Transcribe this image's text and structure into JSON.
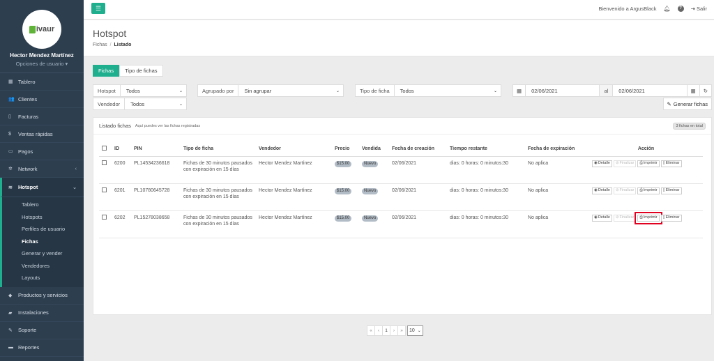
{
  "app": {
    "logo_text": "ivaur",
    "user_name": "Hector Mendez Martínez",
    "user_options": "Opciones de usuario ▾"
  },
  "sidebar": {
    "items_top": [
      {
        "icon": "dashboard-icon",
        "glyph": "▦",
        "label": "Tablero"
      },
      {
        "icon": "users-icon",
        "glyph": "👥",
        "label": "Clientes"
      },
      {
        "icon": "file-icon",
        "glyph": "▯",
        "label": "Facturas"
      },
      {
        "icon": "dollar-icon",
        "glyph": "$",
        "label": "Ventas rápidas"
      },
      {
        "icon": "money-icon",
        "glyph": "▭",
        "label": "Pagos"
      },
      {
        "icon": "network-icon",
        "glyph": "✲",
        "label": "Network",
        "caret": "‹"
      }
    ],
    "active": {
      "icon": "wifi-icon",
      "glyph": "≋",
      "label": "Hotspot",
      "caret": "⌄"
    },
    "subitems": [
      "Tablero",
      "Hotspots",
      "Perfiles de usuario",
      "Fichas",
      "Generar y vender",
      "Vendedores",
      "Layouts"
    ],
    "current_sub": "Fichas",
    "items_bottom": [
      {
        "icon": "tag-icon",
        "glyph": "◆",
        "label": "Productos y servicios"
      },
      {
        "icon": "truck-icon",
        "glyph": "▰",
        "label": "Instalaciones"
      },
      {
        "icon": "wrench-icon",
        "glyph": "✎",
        "label": "Soporte"
      },
      {
        "icon": "book-icon",
        "glyph": "▬",
        "label": "Reportes"
      }
    ]
  },
  "topbar": {
    "welcome": "Bienvenido a ArgusBlack",
    "logout": "Salir"
  },
  "header": {
    "title": "Hotspot",
    "breadcrumb_parent": "Fichas",
    "breadcrumb_sep": "/",
    "breadcrumb_current": "Listado"
  },
  "tabs": [
    "Fichas",
    "Tipo de fichas"
  ],
  "filters": {
    "hotspot_label": "Hotspot",
    "hotspot_value": "Todos",
    "agrupado_label": "Agrupado por",
    "agrupado_value": "Sin agrupar",
    "tipo_label": "Tipo de ficha",
    "tipo_value": "Todos",
    "date_from": "02/06/2021",
    "date_sep": "al",
    "date_to": "02/06/2021",
    "vendedor_label": "Vendedor",
    "vendedor_value": "Todos",
    "generate_button": "Generar fichas"
  },
  "panel": {
    "title": "Listado fichas",
    "subtitle": "Aquí puedes ver las fichas registradas",
    "count": "3 fichas en total"
  },
  "table": {
    "columns": [
      "ID",
      "PIN",
      "Tipo de ficha",
      "Vendedor",
      "Precio",
      "Vendida",
      "Fecha de creación",
      "Tiempo restante",
      "Fecha de expiración",
      "Acción"
    ],
    "actions": [
      "Detalle",
      "Finalizar",
      "Imprimir",
      "Eliminar"
    ],
    "rows": [
      {
        "id": "6200",
        "pin": "PL14534236618",
        "tipo": "Fichas de 30 minutos pausados con expiración en 15 días",
        "vendedor": "Hector Mendez Martínez",
        "precio": "$15.00",
        "vendida": "Nuevo",
        "creacion": "02/06/2021",
        "restante": "dias: 0 horas: 0 minutos:30",
        "expiracion": "No aplica"
      },
      {
        "id": "6201",
        "pin": "PL10780645728",
        "tipo": "Fichas de 30 minutos pausados con expiración en 15 días",
        "vendedor": "Hector Mendez Martínez",
        "precio": "$15.00",
        "vendida": "Nuevo",
        "creacion": "02/06/2021",
        "restante": "dias: 0 horas: 0 minutos:30",
        "expiracion": "No aplica"
      },
      {
        "id": "6202",
        "pin": "PL15278038658",
        "tipo": "Fichas de 30 minutos pausados con expiración en 15 días",
        "vendedor": "Hector Mendez Martínez",
        "precio": "$15.00",
        "vendida": "Nuevo",
        "creacion": "02/06/2021",
        "restante": "dias: 0 horas: 0 minutos:30",
        "expiracion": "No aplica"
      }
    ],
    "highlighted": {
      "row": 2,
      "action": "Imprimir",
      "color": "#e00020"
    }
  },
  "pagination": {
    "first": "«",
    "prev": "‹",
    "page": "1",
    "next": "›",
    "last": "»",
    "page_size": "10"
  },
  "colors": {
    "accent": "#1fae8e",
    "sidebar": "#2d3e4f"
  }
}
